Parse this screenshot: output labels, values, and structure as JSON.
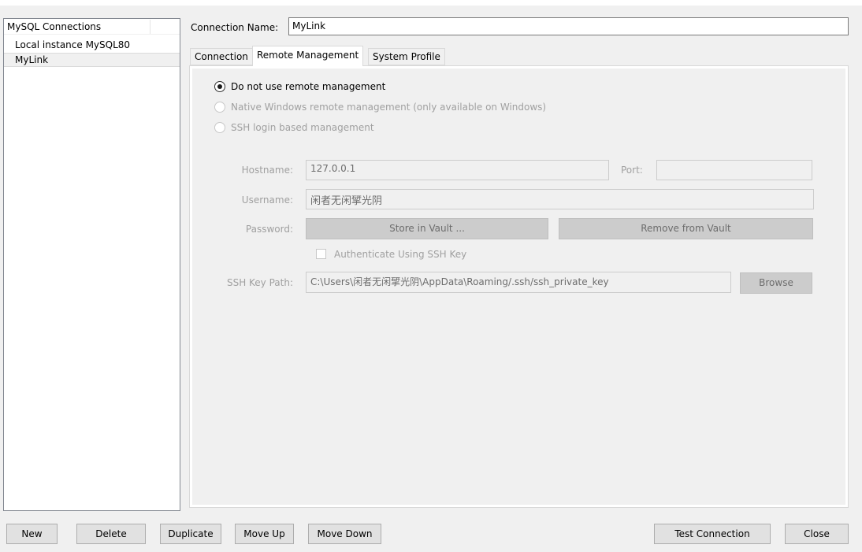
{
  "connections": {
    "header": "MySQL Connections",
    "items": [
      "Local instance MySQL80",
      "MyLink"
    ],
    "selected": "MyLink"
  },
  "connection_name": {
    "label": "Connection Name:",
    "value": "MyLink"
  },
  "tabs": [
    {
      "label": "Connection",
      "active": false
    },
    {
      "label": "Remote Management",
      "active": true
    },
    {
      "label": "System Profile",
      "active": false
    }
  ],
  "remote": {
    "options": [
      {
        "label": "Do not use remote management",
        "selected": true,
        "enabled": true
      },
      {
        "label": "Native Windows remote management (only available on Windows)",
        "selected": false,
        "enabled": false
      },
      {
        "label": "SSH login based management",
        "selected": false,
        "enabled": false
      }
    ],
    "hostname_label": "Hostname:",
    "hostname_value": "127.0.0.1",
    "port_label": "Port:",
    "port_value": "",
    "username_label": "Username:",
    "username_value": "闲者无闲揅光阴",
    "password_label": "Password:",
    "store_vault": "Store in Vault ...",
    "remove_vault": "Remove from Vault",
    "auth_ssh_key": "Authenticate Using SSH Key",
    "ssh_key_label": "SSH Key Path:",
    "ssh_key_value": "C:\\Users\\闲者无闲揅光阴\\AppData\\Roaming/.ssh/ssh_private_key",
    "browse": "Browse"
  },
  "buttons": {
    "new": "New",
    "delete": "Delete",
    "duplicate": "Duplicate",
    "move_up": "Move Up",
    "move_down": "Move Down",
    "test": "Test Connection",
    "close": "Close"
  }
}
